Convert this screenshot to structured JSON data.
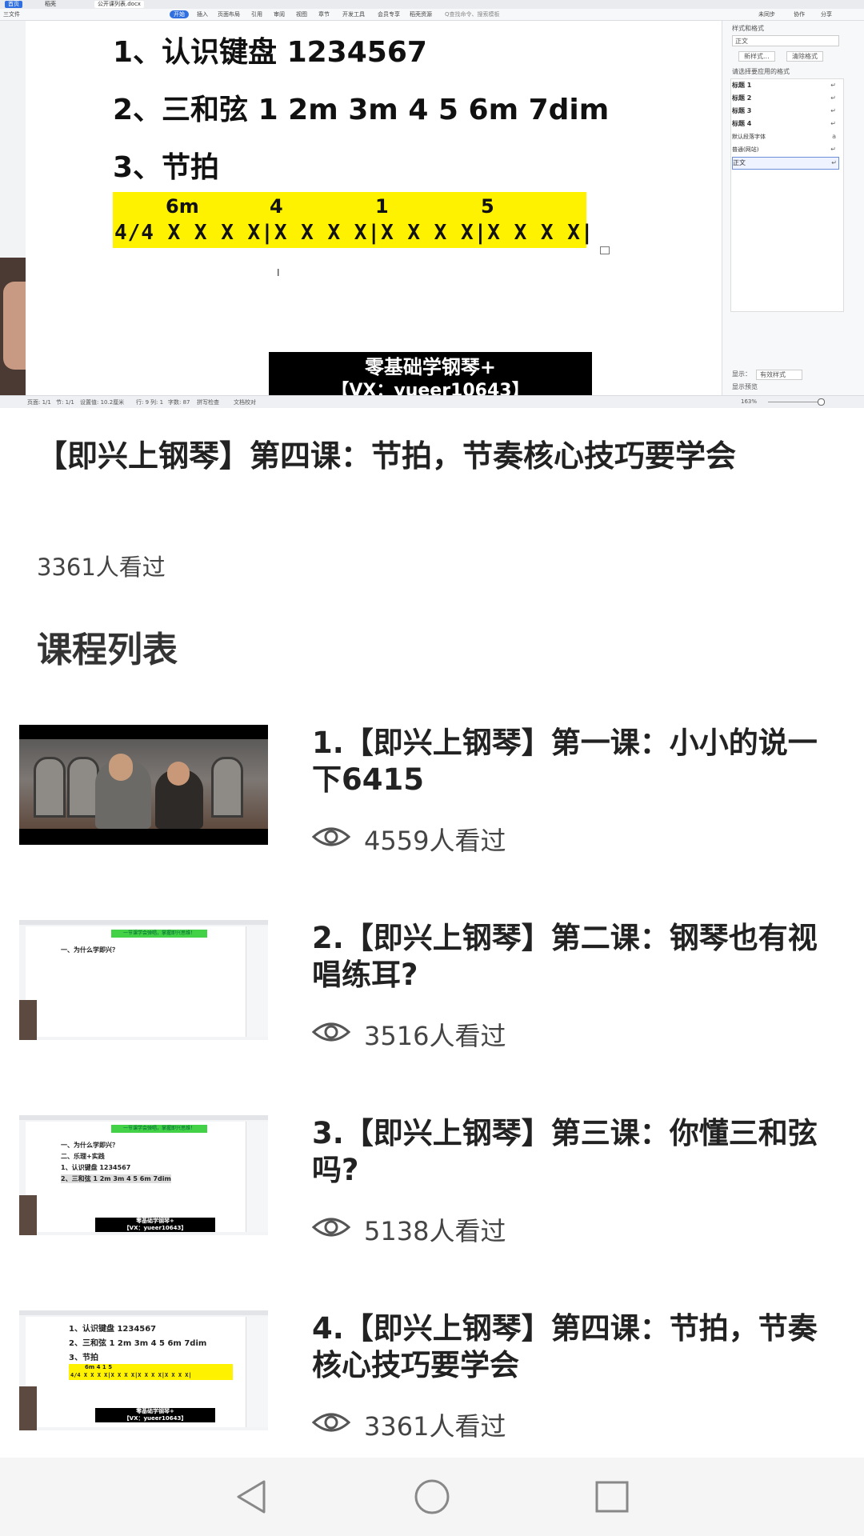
{
  "video": {
    "doc_lines": [
      "1、认识键盘    1234567",
      "2、三和弦    1 2m 3m 4 5 6m 7dim",
      "3、节拍"
    ],
    "chords": [
      "6m",
      "4",
      "1",
      "5"
    ],
    "beat_pattern": "4/4 X X X X|X X X X|X X X X|X X X X|",
    "watermark_line1": "零基础学钢琴+",
    "watermark_line2": "【VX：yueer10643】",
    "app_tabs": [
      "首页",
      "稻壳",
      "公开课列表.docx"
    ],
    "ribbon_items": [
      "三文件",
      "开始",
      "插入",
      "页面布局",
      "引用",
      "审阅",
      "视图",
      "章节",
      "开发工具",
      "会员专享",
      "稻壳资源",
      "Q查找命令、搜索模板",
      "未同步",
      "协作",
      "分享"
    ],
    "side_panel": {
      "title": "样式和格式",
      "current": "正文",
      "btn_new": "新样式...",
      "btn_clear": "清除格式",
      "label": "请选择要应用的格式",
      "styles": [
        "标题 1",
        "标题 2",
        "标题 3",
        "标题 4",
        "默认段落字体",
        "普通(网站)",
        "正文"
      ],
      "show_label": "显示：",
      "show_value": "有效样式",
      "preview": "显示预览"
    },
    "status": [
      "页面: 1/1",
      "节: 1/1",
      "设置值: 10.2厘米",
      "行: 9",
      "列: 1",
      "字数: 87",
      "拼写检查",
      "文档校对",
      "163%"
    ]
  },
  "course": {
    "title": "【即兴上钢琴】第四课：节拍，节奏核心技巧要学会",
    "views": "3361人看过",
    "list_heading": "课程列表"
  },
  "lessons": [
    {
      "title": "1.【即兴上钢琴】第一课：小小的说一下6415",
      "views": "4559人看过"
    },
    {
      "title": "2.【即兴上钢琴】第二课：钢琴也有视唱练耳?",
      "views": "3516人看过"
    },
    {
      "title": "3.【即兴上钢琴】第三课：你懂三和弦吗?",
      "views": "5138人看过"
    },
    {
      "title": "4.【即兴上钢琴】第四课：节拍，节奏核心技巧要学会",
      "views": "3361人看过"
    }
  ],
  "thumbs": {
    "t2_banner": "一节课学会弹唱，掌握即兴思维！",
    "t2_line1": "一、为什么学即兴？",
    "t2_line2": "二、乐理+实践",
    "t3_line3": "1、认识键盘    1234567",
    "t3_line4": "2、三和弦    1 2m 3m 4 5 6m 7dim",
    "t4_line1": "1、认识键盘    1234567",
    "t4_line2": "2、三和弦    1 2m 3m 4 5 6m 7dim",
    "t4_line3": "3、节拍",
    "t4_chords": "6m       4        1        5",
    "t4_beats": "4/4 X X X X|X X X X|X X X X|X X X X|",
    "wm1": "零基础学钢琴+",
    "wm2": "【VX：yueer10643】"
  },
  "nav": {
    "back": "back-icon",
    "home": "home-icon",
    "recents": "recents-icon"
  },
  "colors": {
    "highlight": "#fff200",
    "accent": "#2f6fe0",
    "banner_green": "#43d148"
  }
}
